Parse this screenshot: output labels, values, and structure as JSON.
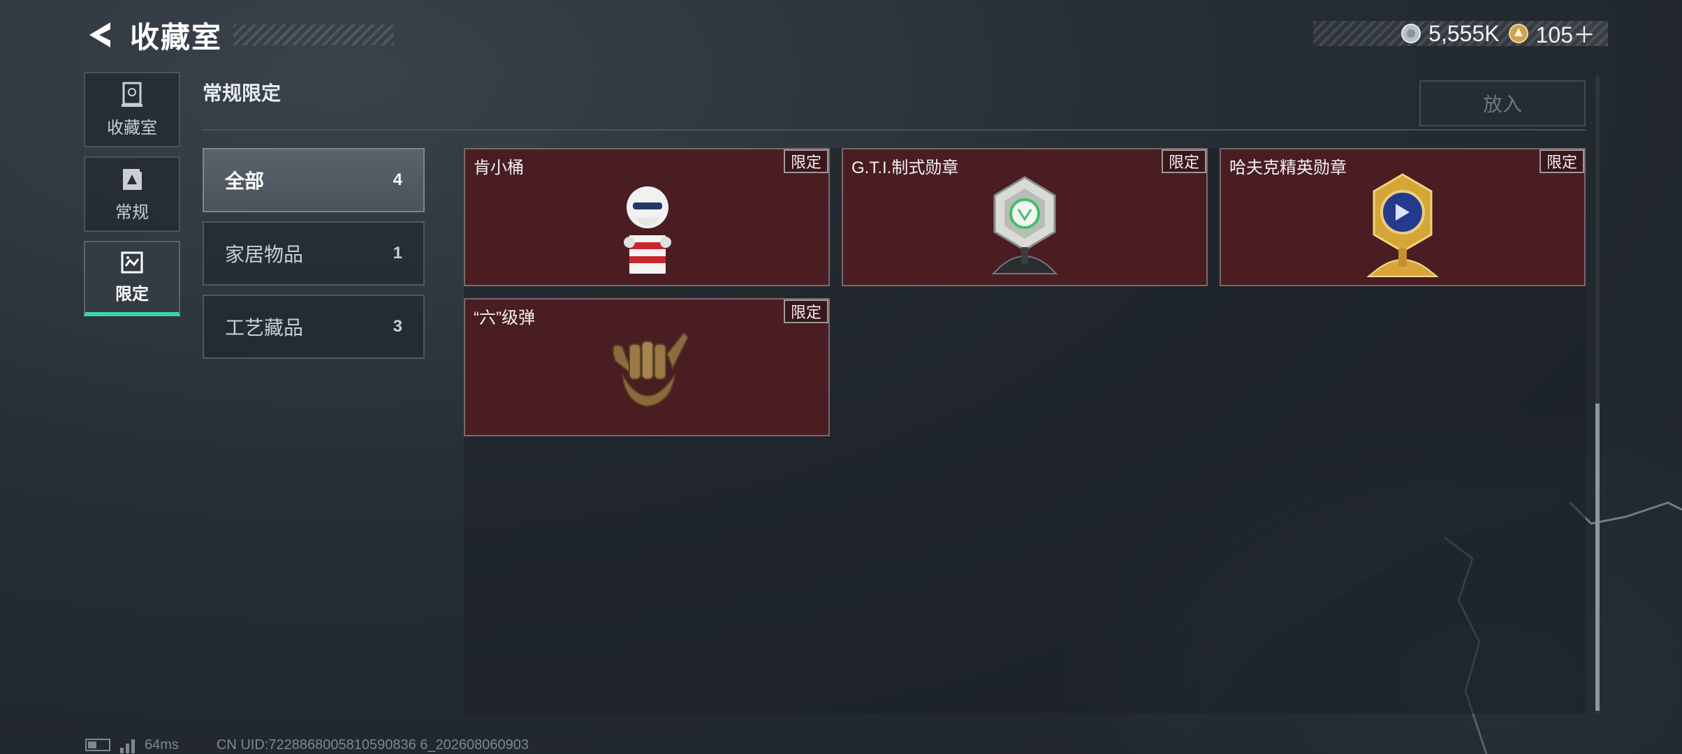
{
  "header": {
    "title": "收藏室",
    "currency": [
      {
        "icon": "silver-coin-icon",
        "value": "5,555K"
      },
      {
        "icon": "gold-coin-icon",
        "value": "105＋"
      }
    ]
  },
  "sidebar": {
    "items": [
      {
        "label": "收藏室",
        "icon": "trophy-case-icon",
        "active": false
      },
      {
        "label": "常规",
        "icon": "card-icon",
        "active": false
      },
      {
        "label": "限定",
        "icon": "limited-card-icon",
        "active": true
      }
    ]
  },
  "section": {
    "title": "常规限定",
    "put_button": "放入"
  },
  "categories": [
    {
      "name": "全部",
      "count": "4",
      "active": true
    },
    {
      "name": "家居物品",
      "count": "1",
      "active": false
    },
    {
      "name": "工艺藏品",
      "count": "3",
      "active": false
    }
  ],
  "items": [
    {
      "name": "肯小桶",
      "badge": "限定",
      "art": "kfc-bucket-figure"
    },
    {
      "name": "G.T.I.制式勋章",
      "badge": "限定",
      "art": "silver-medal"
    },
    {
      "name": "哈夫克精英勋章",
      "badge": "限定",
      "art": "gold-medal"
    },
    {
      "name": "“六”级弹",
      "badge": "限定",
      "art": "bronze-hand-sculpture"
    }
  ],
  "status": {
    "ping": "64ms",
    "uid": "CN UID:7228868005810590836 6_202608060903"
  },
  "colors": {
    "accent": "#3ad6a6",
    "card_bg": "#4a1d22"
  }
}
